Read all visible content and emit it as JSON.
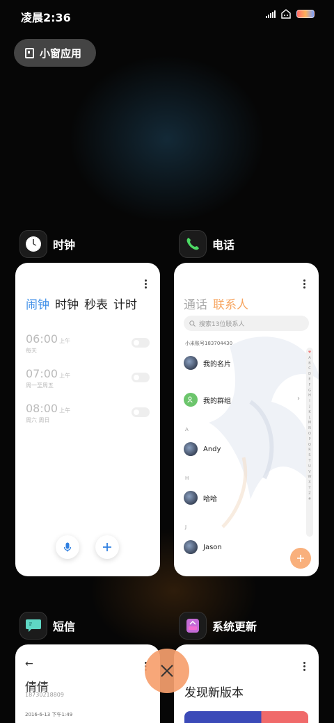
{
  "status_bar": {
    "time": "凌晨2:36",
    "icons": [
      "signal-icon",
      "hotspot-icon",
      "battery-icon"
    ]
  },
  "floating_window_button": {
    "label": "小窗应用",
    "icon": "floating-window-icon"
  },
  "apps": [
    {
      "name": "时钟",
      "icon": "clock-icon"
    },
    {
      "name": "电话",
      "icon": "phone-icon"
    },
    {
      "name": "短信",
      "icon": "sms-icon"
    },
    {
      "name": "系统更新",
      "icon": "system-update-icon"
    }
  ],
  "clock_card": {
    "tabs": [
      "闹钟",
      "时钟",
      "秒表",
      "计时"
    ],
    "active_tab": "闹钟",
    "alarms": [
      {
        "time": "06:00",
        "ampm": "上午",
        "repeat": "每天",
        "enabled": false
      },
      {
        "time": "07:00",
        "ampm": "上午",
        "repeat": "周一至周五",
        "enabled": false
      },
      {
        "time": "08:00",
        "ampm": "上午",
        "repeat": "周六 周日",
        "enabled": false
      }
    ],
    "mic_icon": "microphone-icon",
    "add_icon": "plus-icon"
  },
  "phone_card": {
    "tabs": [
      "通话",
      "联系人"
    ],
    "active_tab": "联系人",
    "search_placeholder": "搜索13位联系人",
    "account": "小米账号183704430",
    "my_card": "我的名片",
    "my_groups": "我的群组",
    "sections": [
      {
        "letter": "A",
        "contact": "Andy"
      },
      {
        "letter": "H",
        "contact": "哈哈"
      },
      {
        "letter": "J",
        "contact": "Jason"
      }
    ],
    "index_letters": [
      "♥",
      "A",
      "B",
      "C",
      "D",
      "E",
      "F",
      "G",
      "H",
      "I",
      "J",
      "K",
      "L",
      "M",
      "N",
      "O",
      "P",
      "Q",
      "R",
      "S",
      "T",
      "U",
      "V",
      "W",
      "X",
      "Y",
      "Z",
      "#"
    ],
    "accent_color": "#f7a560"
  },
  "sms_card": {
    "back_icon": "←",
    "contact_name": "倩倩",
    "phone_number": "18730218809",
    "date": "2016-6-13 下午1:49"
  },
  "update_card": {
    "title": "发现新版本"
  },
  "close_button": {
    "icon": "close-icon",
    "color": "#f6a06e"
  }
}
